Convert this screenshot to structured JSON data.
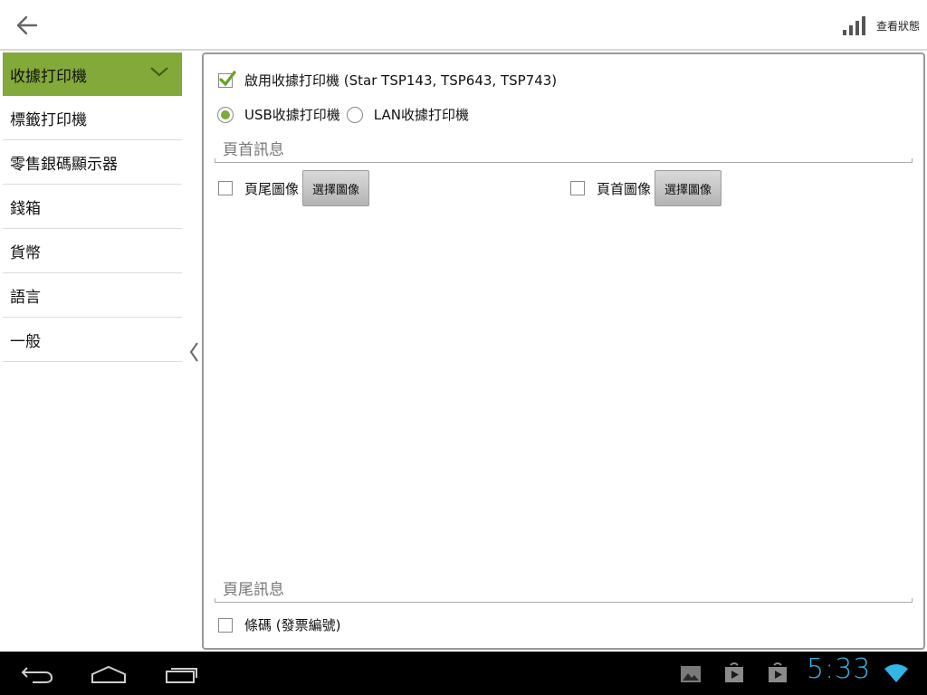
{
  "topbar": {
    "back_icon": "arrow-left-icon",
    "status_icon": "signal-bars-icon",
    "status_label": "查看狀態"
  },
  "sidebar": {
    "items": [
      {
        "label": "收據打印機",
        "active": true
      },
      {
        "label": "標籤打印機",
        "active": false
      },
      {
        "label": "零售銀碼顯示器",
        "active": false
      },
      {
        "label": "錢箱",
        "active": false
      },
      {
        "label": "貨幣",
        "active": false
      },
      {
        "label": "語言",
        "active": false
      },
      {
        "label": "一般",
        "active": false
      }
    ],
    "accent_color": "#82a93a"
  },
  "main": {
    "enable_printer": {
      "label": "啟用收據打印機 (Star TSP143, TSP643, TSP743)",
      "checked": true
    },
    "connection": {
      "usb_label": "USB收據打印機",
      "lan_label": "LAN收據打印機",
      "selected": "usb"
    },
    "header_message": {
      "placeholder": "頁首訊息"
    },
    "footer_image": {
      "label": "頁尾圖像",
      "checked": false,
      "button": "選擇圖像"
    },
    "header_image": {
      "label": "頁首圖像",
      "checked": false,
      "button": "選擇圖像"
    },
    "footer_message": {
      "placeholder": "頁尾訊息"
    },
    "barcode": {
      "label": "條碼 (發票編號)",
      "checked": false
    }
  },
  "system_bar": {
    "time": "5:33",
    "clock_color": "#33b5e5"
  }
}
